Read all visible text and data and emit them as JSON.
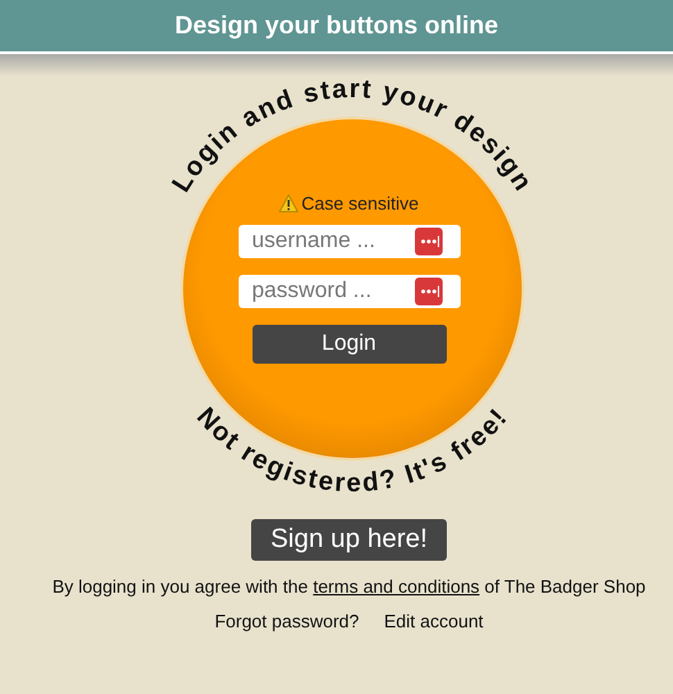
{
  "header": {
    "title": "Design your buttons online"
  },
  "badge": {
    "top_text": "Login and start your design",
    "bottom_text": "Not registered? It's free!"
  },
  "login_form": {
    "notice": "Case sensitive",
    "username": {
      "placeholder": "username ..."
    },
    "password": {
      "placeholder": "password ..."
    },
    "button": "Login"
  },
  "signup_button": "Sign up here!",
  "agreement": {
    "before": "By logging in you agree with the",
    "link": "terms and conditions",
    "after": "of The Badger Shop"
  },
  "links": [
    "Forgot password?",
    "Edit account"
  ]
}
